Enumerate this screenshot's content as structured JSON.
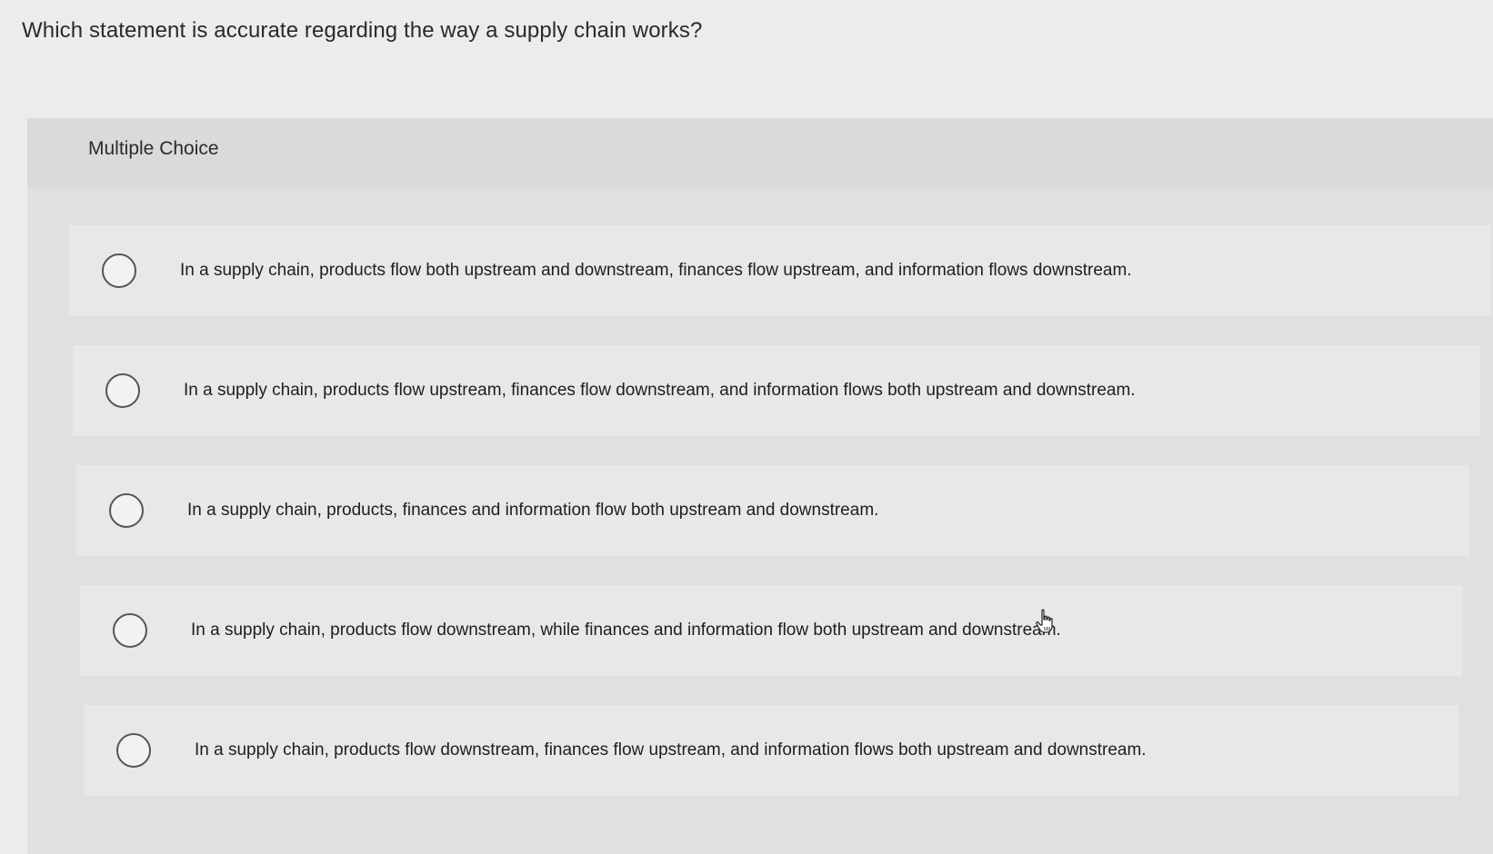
{
  "question": {
    "text": "Which statement is accurate regarding the way a supply chain works?"
  },
  "panel": {
    "label": "Multiple Choice"
  },
  "choices": [
    {
      "text": "In a supply chain, products flow both upstream and downstream, finances flow upstream, and information flows downstream."
    },
    {
      "text": "In a supply chain, products flow upstream, finances flow downstream, and information flows both upstream and downstream."
    },
    {
      "text": "In a supply chain, products, finances and information flow both upstream and downstream."
    },
    {
      "text": "In a supply chain, products flow downstream, while finances and information flow both upstream and downstream."
    },
    {
      "text": "In a supply chain, products flow downstream, finances flow upstream, and information flows both upstream and downstream."
    }
  ],
  "icons": {
    "radio": "radio-unselected-icon",
    "cursor": "hand-pointer-icon"
  }
}
